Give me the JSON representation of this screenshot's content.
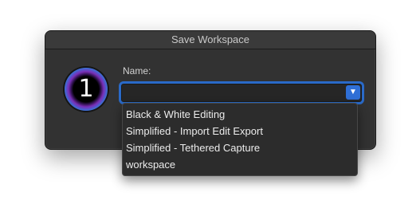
{
  "window": {
    "title": "Save Workspace"
  },
  "app_icon": {
    "name": "capture-one-icon",
    "glyph": "1"
  },
  "form": {
    "name_label": "Name:",
    "name_value": "",
    "dropdown_icon": "chevron-down-icon"
  },
  "dropdown": {
    "items": [
      {
        "label": "Black & White Editing"
      },
      {
        "label": "Simplified - Import Edit Export"
      },
      {
        "label": "Simplified - Tethered Capture"
      },
      {
        "label": "workspace"
      }
    ]
  },
  "colors": {
    "dialog_bg": "#323232",
    "focus_ring": "#2a6ac8",
    "accent_button": "#2f6fd6"
  }
}
